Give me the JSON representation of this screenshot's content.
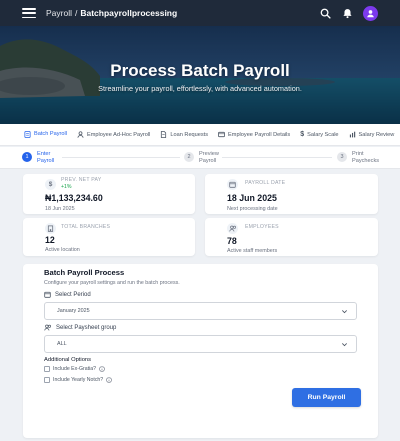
{
  "header": {
    "breadcrumb_base": "Payroll",
    "breadcrumb_sep": "/",
    "breadcrumb_current": "Batchpayrollprocessing",
    "icons": [
      "menu-icon",
      "search-icon",
      "bell-icon",
      "user-avatar-icon"
    ],
    "bg_color": "#1f2a3a",
    "avatar_color": "#7c3aed"
  },
  "hero": {
    "title": "Process Batch Payroll",
    "subtitle": "Streamline your payroll, effortlessly, with advanced automation."
  },
  "tabs": [
    {
      "label": "Batch Payroll",
      "icon": "document-icon",
      "active": true
    },
    {
      "label": "Employee Ad-Hoc Payroll",
      "icon": "user-icon",
      "active": false
    },
    {
      "label": "Loan Requests",
      "icon": "file-icon",
      "active": false
    },
    {
      "label": "Employee Payroll Details",
      "icon": "id-card-icon",
      "active": false
    },
    {
      "label": "Salary Scale",
      "icon": "dollar-icon",
      "active": false
    },
    {
      "label": "Salary Review",
      "icon": "chart-icon",
      "active": false
    }
  ],
  "stepper": {
    "steps": [
      {
        "number": "1",
        "label": "Enter Payroll",
        "active": true
      },
      {
        "number": "2",
        "label": "Preview Payroll",
        "active": false
      },
      {
        "number": "3",
        "label": "Print Paychecks",
        "active": false
      }
    ]
  },
  "stats": {
    "net_pay": {
      "label": "PREV. NET PAY",
      "delta": "+1%",
      "value": "₦1,133,234.60",
      "sub": "18 Jun 2025",
      "icon": "dollar-icon"
    },
    "payroll_date": {
      "label": "PAYROLL DATE",
      "value": "18 Jun 2025",
      "sub": "Next processing date",
      "icon": "calendar-icon"
    },
    "branches": {
      "label": "TOTAL BRANCHES",
      "value": "12",
      "sub": "Active location",
      "icon": "building-icon"
    },
    "employees": {
      "label": "EMPLOYEES",
      "value": "78",
      "sub": "Active staff members",
      "icon": "users-icon"
    }
  },
  "form": {
    "title": "Batch Payroll Process",
    "description": "Configure your payroll settings and run the batch process.",
    "period_label": "Select Period",
    "period_value": "January 2025",
    "paysheet_label": "Select Paysheet group",
    "paysheet_value": "ALL",
    "options_title": "Additional Options",
    "option_ex_gratia": "Include Ex-Gratia?",
    "option_yearly_notch": "Include Yearly Notch?",
    "run_button": "Run Payroll",
    "accent": "#2f6fe3"
  }
}
